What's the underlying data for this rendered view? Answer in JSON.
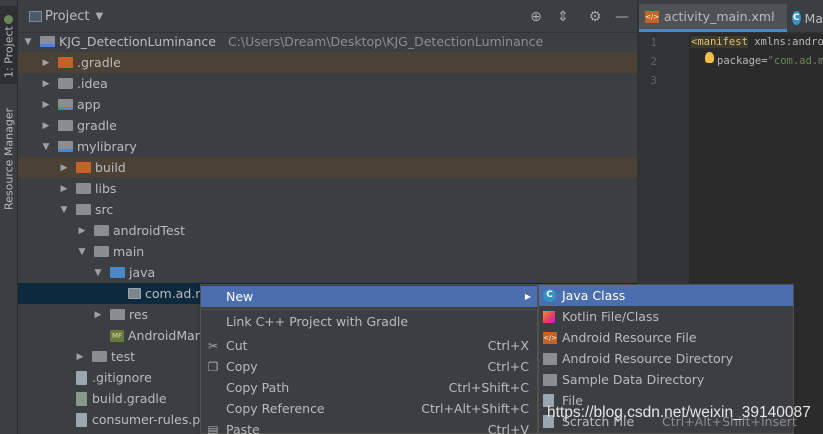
{
  "toolstrip": {
    "project_tab": "1: Project",
    "resource_tab": "Resource Manager"
  },
  "panel": {
    "title": "Project"
  },
  "tree": [
    {
      "label": "KJG_DetectionLuminance",
      "path": "C:\\Users\\Dream\\Desktop\\KJG_DetectionLuminance",
      "depth": 0,
      "expanded": true,
      "icon": "module-folder-icon"
    },
    {
      "label": ".gradle",
      "depth": 1,
      "expanded": false,
      "icon": "folder-orange-icon",
      "highlight": true
    },
    {
      "label": ".idea",
      "depth": 1,
      "expanded": false,
      "icon": "folder-icon"
    },
    {
      "label": "app",
      "depth": 1,
      "expanded": false,
      "icon": "module-folder-icon"
    },
    {
      "label": "gradle",
      "depth": 1,
      "expanded": false,
      "icon": "folder-icon"
    },
    {
      "label": "mylibrary",
      "depth": 1,
      "expanded": true,
      "icon": "library-module-icon"
    },
    {
      "label": "build",
      "depth": 2,
      "expanded": false,
      "icon": "folder-orange-icon",
      "highlight": true
    },
    {
      "label": "libs",
      "depth": 2,
      "expanded": false,
      "icon": "folder-icon"
    },
    {
      "label": "src",
      "depth": 2,
      "expanded": true,
      "icon": "folder-icon"
    },
    {
      "label": "androidTest",
      "depth": 3,
      "expanded": false,
      "icon": "folder-icon"
    },
    {
      "label": "main",
      "depth": 3,
      "expanded": true,
      "icon": "folder-icon"
    },
    {
      "label": "java",
      "depth": 4,
      "expanded": true,
      "icon": "folder-blue-icon"
    },
    {
      "label": "com.ad.m",
      "depth": 5,
      "expanded": null,
      "icon": "package-icon",
      "selected": true
    },
    {
      "label": "res",
      "depth": 4,
      "expanded": false,
      "icon": "folder-icon"
    },
    {
      "label": "AndroidMan",
      "depth": 4,
      "expanded": null,
      "icon": "manifest-icon"
    },
    {
      "label": "test",
      "depth": 3,
      "expanded": false,
      "icon": "folder-icon"
    },
    {
      "label": ".gitignore",
      "depth": 2,
      "expanded": null,
      "icon": "file-icon"
    },
    {
      "label": "build.gradle",
      "depth": 2,
      "expanded": null,
      "icon": "gradle-icon"
    },
    {
      "label": "consumer-rules.pro",
      "depth": 2,
      "expanded": null,
      "icon": "file-icon"
    }
  ],
  "editor": {
    "tabs": [
      {
        "label": "activity_main.xml",
        "icon": "xml-icon",
        "active": true
      },
      {
        "label": "Ma",
        "icon": "class-icon",
        "active": false
      }
    ],
    "line_numbers": [
      "1",
      "2",
      "3"
    ],
    "code": {
      "line1_tag": "<manifest",
      "line1_attr": " xmlns:andro",
      "line2_attr": "package=",
      "line2_val": "\"com.ad.m"
    }
  },
  "context_menu": {
    "items": [
      {
        "label": "New",
        "shortcut": "",
        "has_submenu": true,
        "active": true,
        "icon": ""
      },
      {
        "label": "Link C++ Project with Gradle",
        "shortcut": "",
        "icon": ""
      },
      {
        "label": "Cut",
        "shortcut": "Ctrl+X",
        "icon": "scissors-icon"
      },
      {
        "label": "Copy",
        "shortcut": "Ctrl+C",
        "icon": "copy-icon"
      },
      {
        "label": "Copy Path",
        "shortcut": "Ctrl+Shift+C",
        "icon": ""
      },
      {
        "label": "Copy Reference",
        "shortcut": "Ctrl+Alt+Shift+C",
        "icon": ""
      },
      {
        "label": "Paste",
        "shortcut": "Ctrl+V",
        "icon": "paste-icon"
      }
    ]
  },
  "submenu": {
    "items": [
      {
        "label": "Java Class",
        "icon": "java-class-icon",
        "active": true
      },
      {
        "label": "Kotlin File/Class",
        "icon": "kotlin-icon"
      },
      {
        "label": "Android Resource File",
        "icon": "android-resource-file-icon"
      },
      {
        "label": "Android Resource Directory",
        "icon": "folder-icon"
      },
      {
        "label": "Sample Data Directory",
        "icon": "folder-icon"
      },
      {
        "label": "File",
        "icon": "file-icon"
      },
      {
        "label": "Scratch File",
        "shortcut": "Ctrl+Alt+Shift+Insert",
        "icon": "scratch-file-icon"
      }
    ]
  },
  "watermark": "https://blog.csdn.net/weixin_39140087"
}
